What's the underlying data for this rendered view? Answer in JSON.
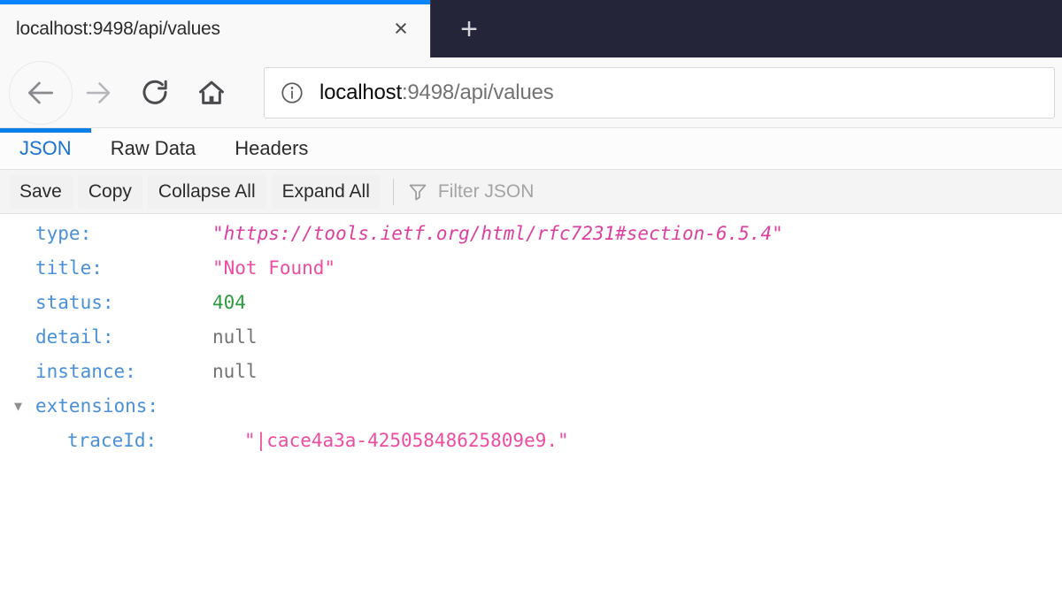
{
  "browser": {
    "tab": {
      "title": "localhost:9498/api/values",
      "close_label": "×",
      "close_icon": "close-icon"
    },
    "new_tab_label": "+",
    "nav": {
      "back_icon": "back-arrow-icon",
      "forward_icon": "forward-arrow-icon",
      "reload_icon": "reload-icon",
      "home_icon": "home-icon"
    },
    "urlbar": {
      "info_icon": "info-icon",
      "host": "localhost",
      "path": ":9498/api/values",
      "full_url": "localhost:9498/api/values"
    }
  },
  "json_viewer": {
    "tabs": [
      {
        "label": "JSON",
        "active": true
      },
      {
        "label": "Raw Data",
        "active": false
      },
      {
        "label": "Headers",
        "active": false
      }
    ],
    "toolbar": {
      "save_label": "Save",
      "copy_label": "Copy",
      "collapse_all_label": "Collapse All",
      "expand_all_label": "Expand All",
      "filter_icon": "filter-icon",
      "filter_placeholder": "Filter JSON"
    },
    "rows": [
      {
        "key": "type:",
        "value": "\"https://tools.ietf.org/html/rfc7231#section-6.5.4\"",
        "kind": "link",
        "indent": 0,
        "twisty": ""
      },
      {
        "key": "title:",
        "value": "\"Not Found\"",
        "kind": "string",
        "indent": 0,
        "twisty": ""
      },
      {
        "key": "status:",
        "value": "404",
        "kind": "number",
        "indent": 0,
        "twisty": ""
      },
      {
        "key": "detail:",
        "value": "null",
        "kind": "null",
        "indent": 0,
        "twisty": ""
      },
      {
        "key": "instance:",
        "value": "null",
        "kind": "null",
        "indent": 0,
        "twisty": ""
      },
      {
        "key": "extensions:",
        "value": "",
        "kind": "none",
        "indent": 0,
        "twisty": "▼"
      },
      {
        "key": "traceId:",
        "value": "\"|cace4a3a-42505848625809e9.\"",
        "kind": "string",
        "indent": 1,
        "twisty": ""
      }
    ]
  },
  "colors": {
    "tab_accent": "#0a84ff",
    "newtab_bg": "#242538",
    "json_key": "#4a90d9",
    "json_string": "#ed4ca2",
    "json_link": "#dd3fa0",
    "json_number": "#2e9b41",
    "json_null": "#737373",
    "active_tab_text": "#1a73cf"
  }
}
